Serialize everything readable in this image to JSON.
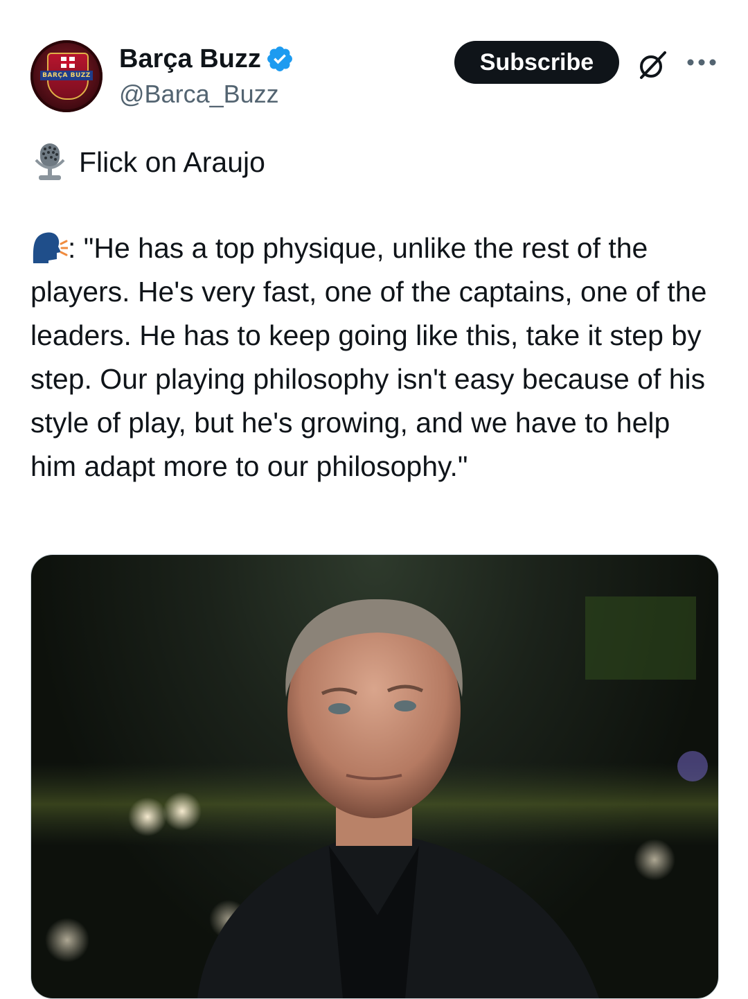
{
  "account": {
    "display_name": "Barça Buzz",
    "handle": "@Barca_Buzz",
    "avatar_text": "BARÇA BUZZ",
    "verified_color": "#1d9bf0"
  },
  "actions": {
    "subscribe_label": "Subscribe"
  },
  "post": {
    "title": "Flick on Araujo",
    "quote_prefix": ": ",
    "quote": "\"He has a top physique, unlike the rest of the players. He's very fast, one of the captains, one of the leaders. He has to keep going like this, take it step by step. Our playing philosophy isn't easy because of his style of play, but he's growing, and we have to help him adapt more to our philosophy.\""
  },
  "icons": {
    "mic": "studio-microphone-icon",
    "speaker": "speaking-head-icon",
    "grok": "grok-icon",
    "more": "more-options-icon",
    "verified": "verified-badge-icon"
  }
}
